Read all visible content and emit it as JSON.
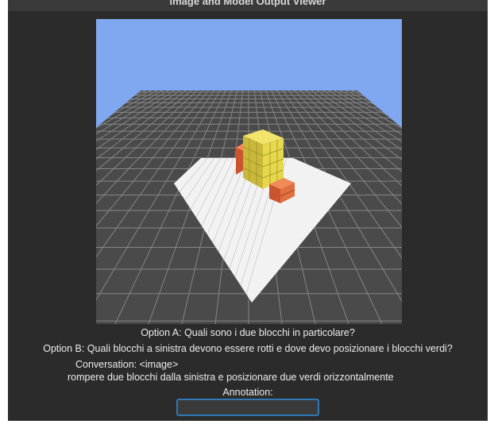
{
  "window": {
    "title": "Image and Model Output Viewer"
  },
  "scene": {
    "description_icon": "3d-block-scene",
    "colors": {
      "sky": "#7fa8f0",
      "floor_dark": "#4a4a4a",
      "floor_lines": "#9a9a9a",
      "mat": "#f2f2f2",
      "yellow_block": "#e6d84a",
      "orange_block": "#d9653a"
    }
  },
  "prompts": {
    "option_a": "Option A: Quali sono i due blocchi in particolare?",
    "option_b": "Option B: Quali blocchi a sinistra devono essere rotti e dove devo posizionare i blocchi verdi?",
    "conversation_label": "Conversation: <image>",
    "conversation_text": "rompere due blocchi dalla sinistra e posizionare due verdi orizzontalmente"
  },
  "annotation": {
    "label": "Annotation:",
    "value": "",
    "placeholder": ""
  }
}
